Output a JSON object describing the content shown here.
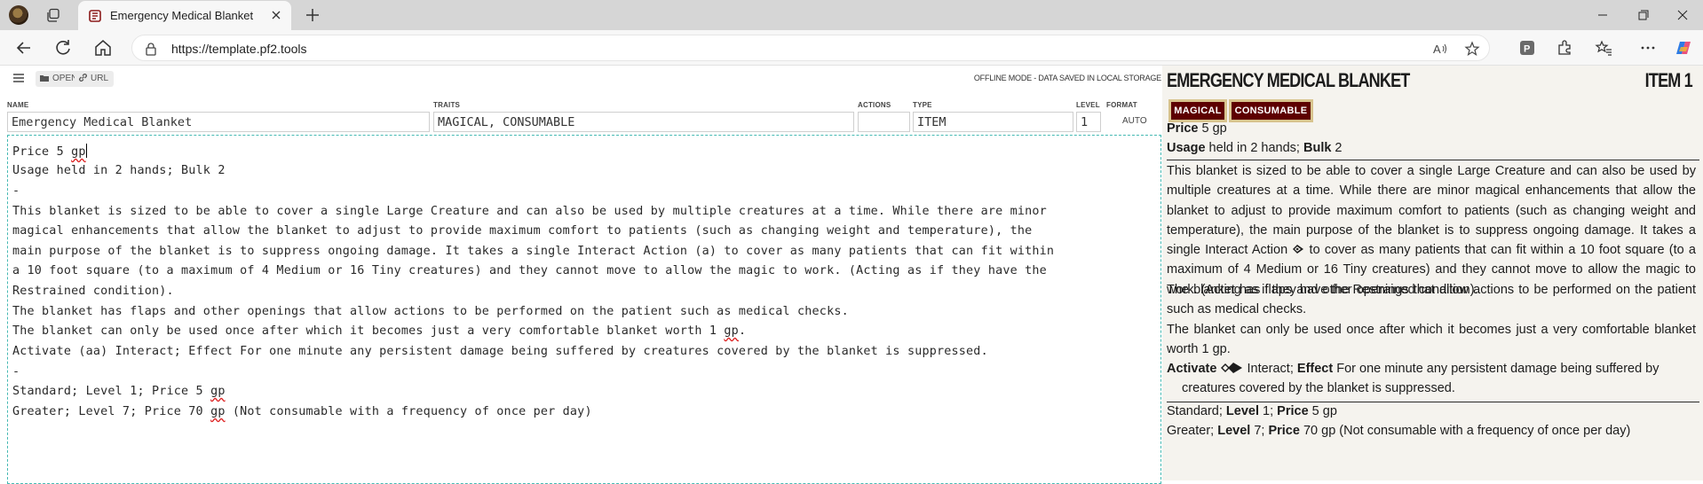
{
  "browser": {
    "tab_title": "Emergency Medical Blanket",
    "url": "https://template.pf2.tools"
  },
  "app_toolbar": {
    "open_label": "OPEN",
    "url_label": "URL",
    "offline_status": "OFFLINE MODE - DATA SAVED IN LOCAL STORAGE"
  },
  "form": {
    "name_label": "NAME",
    "name_value": "Emergency Medical Blanket",
    "traits_label": "TRAITS",
    "traits_value": "MAGICAL, CONSUMABLE",
    "actions_label": "ACTIONS",
    "actions_value": "",
    "type_label": "TYPE",
    "type_value": "ITEM",
    "level_label": "LEVEL",
    "level_value": "1",
    "format_label": "FORMAT",
    "format_value": "AUTO"
  },
  "editor": {
    "line1_pre": "Price 5 ",
    "line1_sq": "gp",
    "line2": "Usage held in 2 hands; Bulk 2",
    "sep1": "-",
    "p1_l1": "This blanket is sized to be able to cover a single Large Creature and can also be used by multiple creatures at a time. While there are minor",
    "p1_l2": "magical enhancements that allow the blanket to adjust to provide maximum comfort to patients (such as changing weight and temperature), the",
    "p1_l3": "main purpose of the blanket is to suppress ongoing damage. It takes a single Interact Action (a) to cover as many patients that can fit within",
    "p1_l4": "a 10 foot square (to a maximum of 4 Medium or 16 Tiny creatures) and they cannot move to allow the magic to work. (Acting as if they have the",
    "p1_l5": "Restrained condition).",
    "p2": "The blanket has flaps and other openings that allow actions to be performed on the patient such as medical checks.",
    "p3_pre": "The blanket can only be used once after which it becomes just a very comfortable blanket worth 1 ",
    "p3_sq": "gp",
    "p3_post": ".",
    "activate": "Activate (aa) Interact; Effect For one minute any persistent damage being suffered by creatures covered by the blanket is suppressed.",
    "sep2": "-",
    "v1_pre": "Standard; Level 1; Price 5 ",
    "v1_sq": "gp",
    "v2_pre": "Greater; Level 7; Price 70 ",
    "v2_sq": "gp",
    "v2_post": " (Not consumable with a frequency of once per day)"
  },
  "preview": {
    "title": "EMERGENCY MEDICAL BLANKET",
    "level": "ITEM 1",
    "traits": [
      "MAGICAL",
      "CONSUMABLE"
    ],
    "price_label": "Price",
    "price_value": " 5 gp",
    "usage_label": "Usage",
    "usage_value": " held in 2 hands; ",
    "bulk_label": "Bulk",
    "bulk_value": " 2",
    "desc_before": "This blanket is sized to be able to cover a single Large Creature and can also be used by multiple creatures at a time. While there are minor magical enhancements that allow the blanket to adjust to provide maximum comfort to patients (such as changing weight and temperature), the main purpose of the blanket is to suppress ongoing damage. It takes a single Interact Action",
    "desc_after": " to cover as many patients that can fit within a 10 foot square (to a maximum of 4 Medium or 16 Tiny creatures) and they cannot move to allow the magic to work. (Acting as if they have the Restrained condition).",
    "flaps": "The blanket has flaps and other openings that allow actions to be performed on the patient such as medical checks.",
    "once": "The blanket can only be used once after which it becomes just a very comfortable blanket worth 1 gp.",
    "activate_label": "Activate",
    "activate_text": " Interact; ",
    "effect_label": "Effect",
    "effect_text": " For one minute any persistent damage being suffered by",
    "effect_text2": "creatures covered by the blanket is suppressed.",
    "v1_name": "Standard; ",
    "v1_level_label": "Level",
    "v1_level": " 1; ",
    "v1_price_label": "Price",
    "v1_price": " 5 gp",
    "v2_name": "Greater; ",
    "v2_level_label": "Level",
    "v2_level": " 7; ",
    "v2_price_label": "Price",
    "v2_price": " 70 gp (Not consumable with a frequency of once per day)"
  },
  "colors": {
    "trait_bg": "#5d0000",
    "trait_border": "#d8c48e",
    "editor_border": "#46b9b3",
    "preview_bg": "#f5f3ee"
  },
  "icons": [
    "profile-avatar",
    "tab-actions-icon",
    "favicon-icon",
    "close-icon",
    "plus-icon",
    "minimize-icon",
    "restore-icon",
    "window-close-icon",
    "back-icon",
    "refresh-icon",
    "home-icon",
    "lock-icon",
    "read-aloud-icon",
    "favorite-icon",
    "extension-icon",
    "favorites-icon",
    "more-icon",
    "copilot-icon",
    "menu-icon",
    "folder-icon",
    "link-icon",
    "action-icon"
  ]
}
